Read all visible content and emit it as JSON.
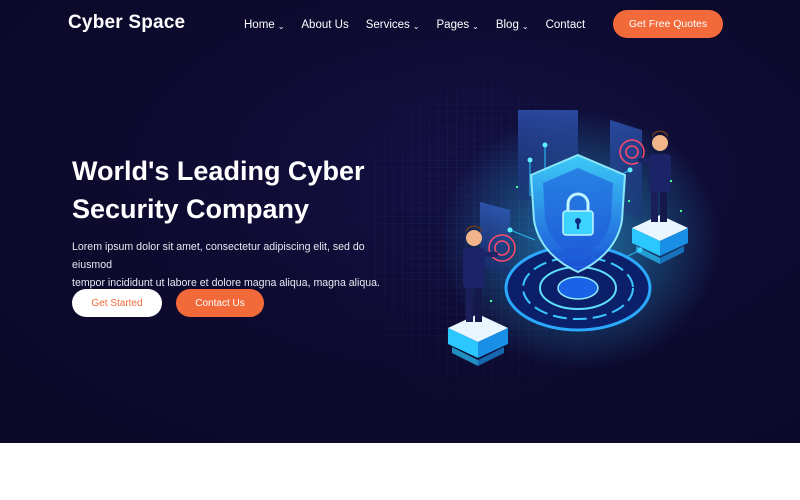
{
  "brand": {
    "name": "Cyber Space"
  },
  "nav": {
    "items": [
      {
        "label": "Home",
        "dropdown": true
      },
      {
        "label": "About Us",
        "dropdown": false
      },
      {
        "label": "Services",
        "dropdown": true
      },
      {
        "label": "Pages",
        "dropdown": true
      },
      {
        "label": "Blog",
        "dropdown": true
      },
      {
        "label": "Contact",
        "dropdown": false
      }
    ],
    "cta_label": "Get Free Quotes"
  },
  "hero": {
    "title_line1": "World's Leading Cyber",
    "title_line2": "Security Company",
    "description_line1": "Lorem ipsum dolor sit amet, consectetur adipiscing elit, sed do eiusmod",
    "description_line2": "tempor incididunt ut labore et dolore magna aliqua, magna aliqua.",
    "primary_button": "Get Started",
    "secondary_button": "Contact Us"
  },
  "icons": {
    "dropdown": "chevron-down-icon",
    "illustration": "shield-lock-illustration"
  },
  "colors": {
    "hero_bg": "#0d0a2e",
    "accent": "#f36a3a",
    "glow": "#29c6ff",
    "white": "#ffffff"
  }
}
